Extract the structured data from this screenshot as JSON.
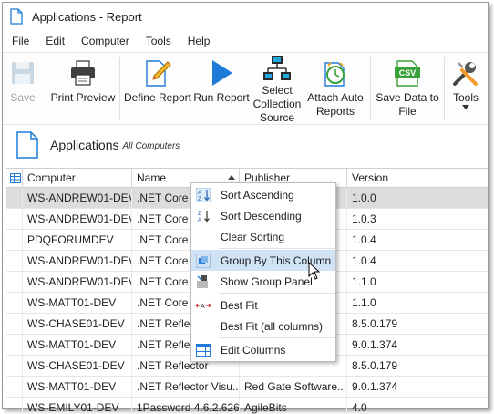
{
  "window": {
    "title": "Applications - Report"
  },
  "menu": [
    "File",
    "Edit",
    "Computer",
    "Tools",
    "Help"
  ],
  "ribbon": {
    "save": "Save",
    "print_preview": "Print Preview",
    "define_report": "Define Report",
    "run_report": "Run Report",
    "select_source": [
      "Select",
      "Collection",
      "Source"
    ],
    "attach_auto": [
      "Attach Auto",
      "Reports"
    ],
    "save_to_file": [
      "Save Data to",
      "File"
    ],
    "csv_badge": "CSV",
    "tools": "Tools"
  },
  "section": {
    "title": "Applications",
    "subtitle": "All Computers"
  },
  "columns": [
    "Computer",
    "Name",
    "Publisher",
    "Version"
  ],
  "rows": [
    [
      "WS-ANDREW01-DEV",
      ".NET Core SDK",
      "",
      "1.0.0"
    ],
    [
      "WS-ANDREW01-DEV",
      ".NET Core SDK",
      "",
      "1.0.3"
    ],
    [
      "PDQFORUMDEV",
      ".NET Core SDK",
      "",
      "1.0.4"
    ],
    [
      "WS-ANDREW01-DEV",
      ".NET Core SDK",
      "",
      "1.0.4"
    ],
    [
      "WS-ANDREW01-DEV",
      ".NET Core SDK",
      "",
      "1.1.0"
    ],
    [
      "WS-MATT01-DEV",
      ".NET Core SDK",
      "",
      "1.1.0"
    ],
    [
      "WS-CHASE01-DEV",
      ".NET Reflector",
      "",
      "8.5.0.179"
    ],
    [
      "WS-MATT01-DEV",
      ".NET Reflector",
      "",
      "9.0.1.374"
    ],
    [
      "WS-CHASE01-DEV",
      ".NET Reflector",
      "",
      "8.5.0.179"
    ],
    [
      "WS-MATT01-DEV",
      ".NET Reflector Visu...",
      "Red Gate Software...",
      "9.0.1.374"
    ],
    [
      "WS-EMILY01-DEV",
      "1Password 4.6.2.626",
      "AgileBits",
      "4.0"
    ]
  ],
  "context_menu": {
    "sort_ascending": "Sort Ascending",
    "sort_descending": "Sort Descending",
    "clear_sorting": "Clear Sorting",
    "group_by": "Group By This Column",
    "show_group_panel": "Show Group Panel",
    "best_fit": "Best Fit",
    "best_fit_all": "Best Fit (all columns)",
    "edit_columns": "Edit Columns"
  }
}
